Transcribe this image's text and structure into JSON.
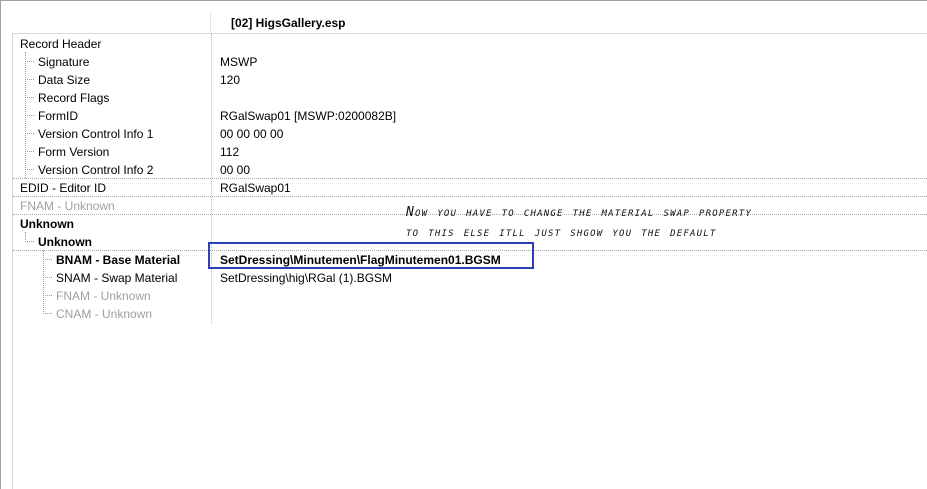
{
  "header": {
    "title": "[02] HigsGallery.esp"
  },
  "rows": [
    {
      "label": "Record Header",
      "value": ""
    },
    {
      "label": "Signature",
      "value": "MSWP"
    },
    {
      "label": "Data Size",
      "value": "120"
    },
    {
      "label": "Record Flags",
      "value": ""
    },
    {
      "label": "FormID",
      "value": "RGalSwap01 [MSWP:0200082B]"
    },
    {
      "label": "Version Control Info 1",
      "value": "00 00 00 00"
    },
    {
      "label": "Form Version",
      "value": "112"
    },
    {
      "label": "Version Control Info 2",
      "value": "00 00"
    },
    {
      "label": "EDID - Editor ID",
      "value": "RGalSwap01"
    },
    {
      "label": "FNAM - Unknown",
      "value": ""
    },
    {
      "label": "Unknown",
      "value": ""
    },
    {
      "label": "Unknown",
      "value": ""
    },
    {
      "label": "BNAM - Base Material",
      "value": "SetDressing\\Minutemen\\FlagMinutemen01.BGSM"
    },
    {
      "label": "SNAM - Swap Material",
      "value": "SetDressing\\hig\\RGal (1).BGSM"
    },
    {
      "label": "FNAM - Unknown",
      "value": ""
    },
    {
      "label": "CNAM - Unknown",
      "value": ""
    }
  ],
  "annotation": {
    "line1": "Now you have to change the material swap property",
    "line2": "to this else itll just shgow you the default"
  },
  "colors": {
    "highlight_border": "#2a3fb8",
    "disabled_text": "#a0a0a0"
  }
}
